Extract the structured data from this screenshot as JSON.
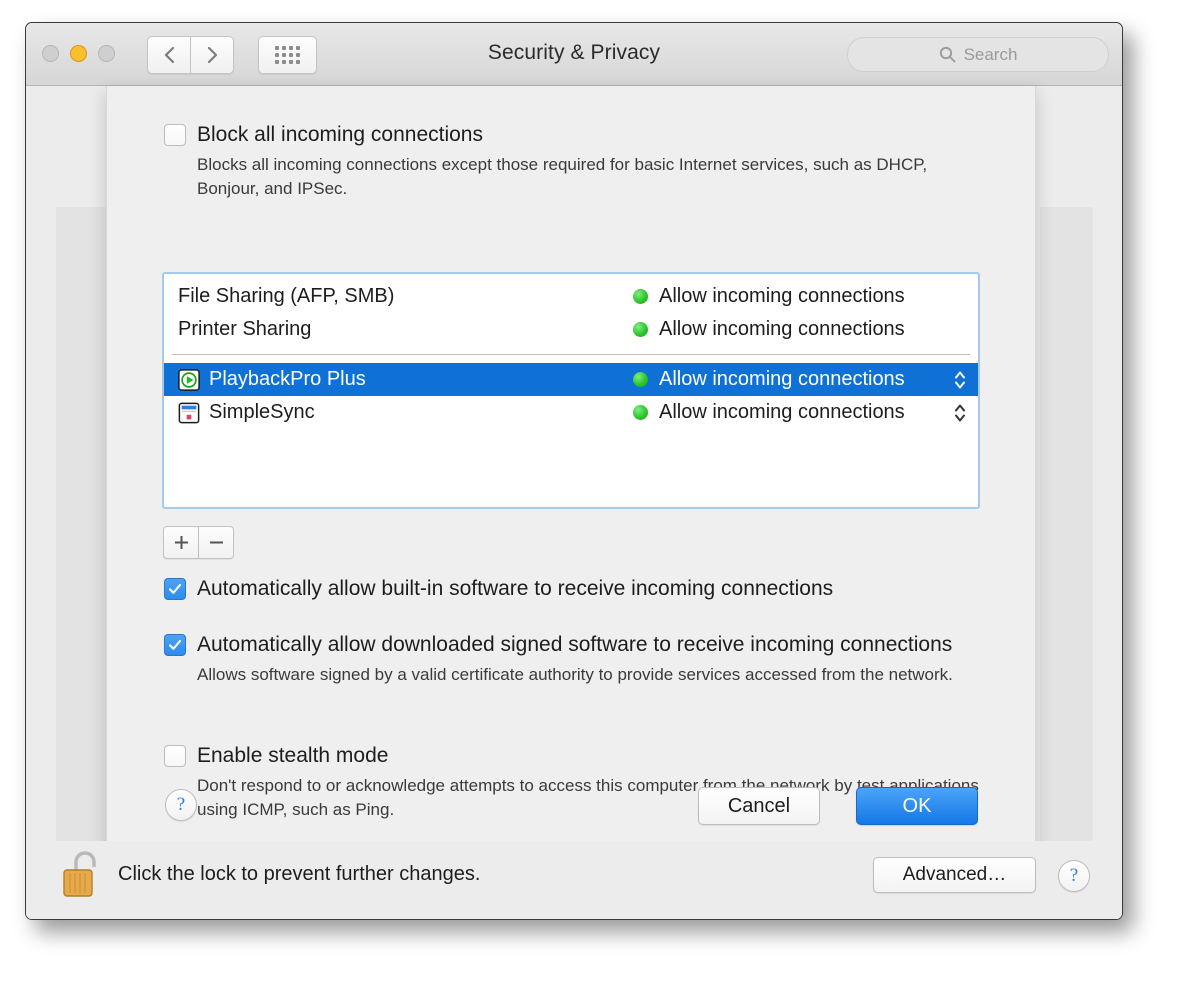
{
  "window": {
    "title": "Security & Privacy",
    "traffic_lights": [
      "close-button",
      "minimize-button",
      "zoom-button"
    ],
    "nav": {
      "back_icon": "chevron-left-icon",
      "forward_icon": "chevron-right-icon",
      "grid_icon": "show-all-grid-icon"
    },
    "search": {
      "placeholder": "Search",
      "value": "",
      "icon": "search-icon"
    }
  },
  "sheet": {
    "block_all": {
      "label": "Block all incoming connections",
      "checked": false,
      "description": "Blocks all incoming connections except those required for basic Internet services,  such as DHCP, Bonjour, and IPSec."
    },
    "list": {
      "system_services": [
        {
          "name": "File Sharing (AFP, SMB)",
          "status": "Allow incoming connections",
          "status_color": "#2ec52e",
          "icon": null,
          "selected": false,
          "has_stepper": false
        },
        {
          "name": "Printer Sharing",
          "status": "Allow incoming connections",
          "status_color": "#2ec52e",
          "icon": null,
          "selected": false,
          "has_stepper": false
        }
      ],
      "applications": [
        {
          "name": "PlaybackPro Plus",
          "status": "Allow incoming connections",
          "status_color": "#2ec52e",
          "icon": "playbackpro-app-icon",
          "selected": true,
          "has_stepper": true
        },
        {
          "name": "SimpleSync",
          "status": "Allow incoming connections",
          "status_color": "#2ec52e",
          "icon": "simplesync-app-icon",
          "selected": false,
          "has_stepper": true
        }
      ]
    },
    "list_controls": {
      "add_label": "+",
      "remove_label": "−"
    },
    "auto_builtin": {
      "label": "Automatically allow built-in software to receive incoming connections",
      "checked": true
    },
    "auto_signed": {
      "label": "Automatically allow downloaded signed software to receive incoming connections",
      "checked": true,
      "description": "Allows software signed by a valid certificate authority to provide services accessed from the network."
    },
    "stealth_mode": {
      "label": "Enable stealth mode",
      "checked": false,
      "description": "Don't respond to or acknowledge attempts to access this computer from the network by test applications using ICMP, such as Ping."
    },
    "footer": {
      "help_label": "?",
      "cancel_label": "Cancel",
      "ok_label": "OK"
    }
  },
  "bottom_bar": {
    "lock_icon": "unlocked-padlock-icon",
    "lock_text": "Click the lock to prevent further changes.",
    "advanced_label": "Advanced…",
    "help_label": "?"
  },
  "colors": {
    "selection_blue": "#0f70d6",
    "status_green": "#2ec52e",
    "default_button_blue": "#1478e8",
    "focus_ring": "#a3c9ef"
  }
}
